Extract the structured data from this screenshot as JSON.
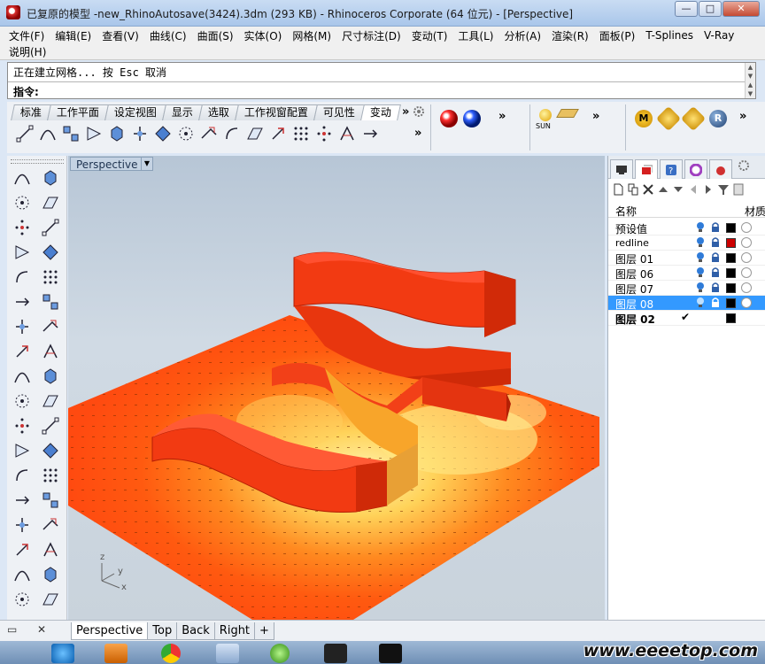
{
  "window": {
    "title": "已复原的模型 -new_RhinoAutosave(3424).3dm (293 KB) - Rhinoceros Corporate (64 位元) - [Perspective]",
    "minimize": "—",
    "maximize": "□",
    "close": "✕"
  },
  "menu": {
    "row1": [
      "文件(F)",
      "编辑(E)",
      "查看(V)",
      "曲线(C)",
      "曲面(S)",
      "实体(O)",
      "网格(M)",
      "尺寸标注(D)",
      "变动(T)",
      "工具(L)",
      "分析(A)",
      "渲染(R)",
      "面板(P)",
      "T-Splines",
      "V-Ray"
    ],
    "row2": [
      "说明(H)"
    ]
  },
  "command": {
    "history": "正在建立网格... 按 Esc 取消",
    "prompt": "指令:",
    "value": ""
  },
  "toolbar": {
    "tabs": [
      "标准",
      "工作平面",
      "设定视图",
      "显示",
      "选取",
      "工作视窗配置",
      "可见性",
      "变动"
    ],
    "more": "»",
    "sun_label": "SUN"
  },
  "viewport": {
    "name": "Perspective",
    "axis_z": "z",
    "axis_y": "y",
    "axis_x": "x"
  },
  "layers_panel": {
    "col_name": "名称",
    "col_material": "材质",
    "rows": [
      {
        "name": "预设值",
        "color": "#000000",
        "style": ""
      },
      {
        "name": "redline",
        "color": "#cc0000",
        "style": "small"
      },
      {
        "name": "图层 01",
        "color": "#000000",
        "style": ""
      },
      {
        "name": "图层 06",
        "color": "#000000",
        "style": ""
      },
      {
        "name": "图层 07",
        "color": "#000000",
        "style": ""
      },
      {
        "name": "图层 08",
        "color": "#000000",
        "style": "",
        "selected": true
      },
      {
        "name": "图层 02",
        "color": "#000000",
        "style": "bold",
        "current": true
      }
    ],
    "current_mark": "✔"
  },
  "view_tabs": [
    "Perspective",
    "Top",
    "Back",
    "Right"
  ],
  "view_tab_add": "+",
  "watermark": "www.eeeetop.com"
}
